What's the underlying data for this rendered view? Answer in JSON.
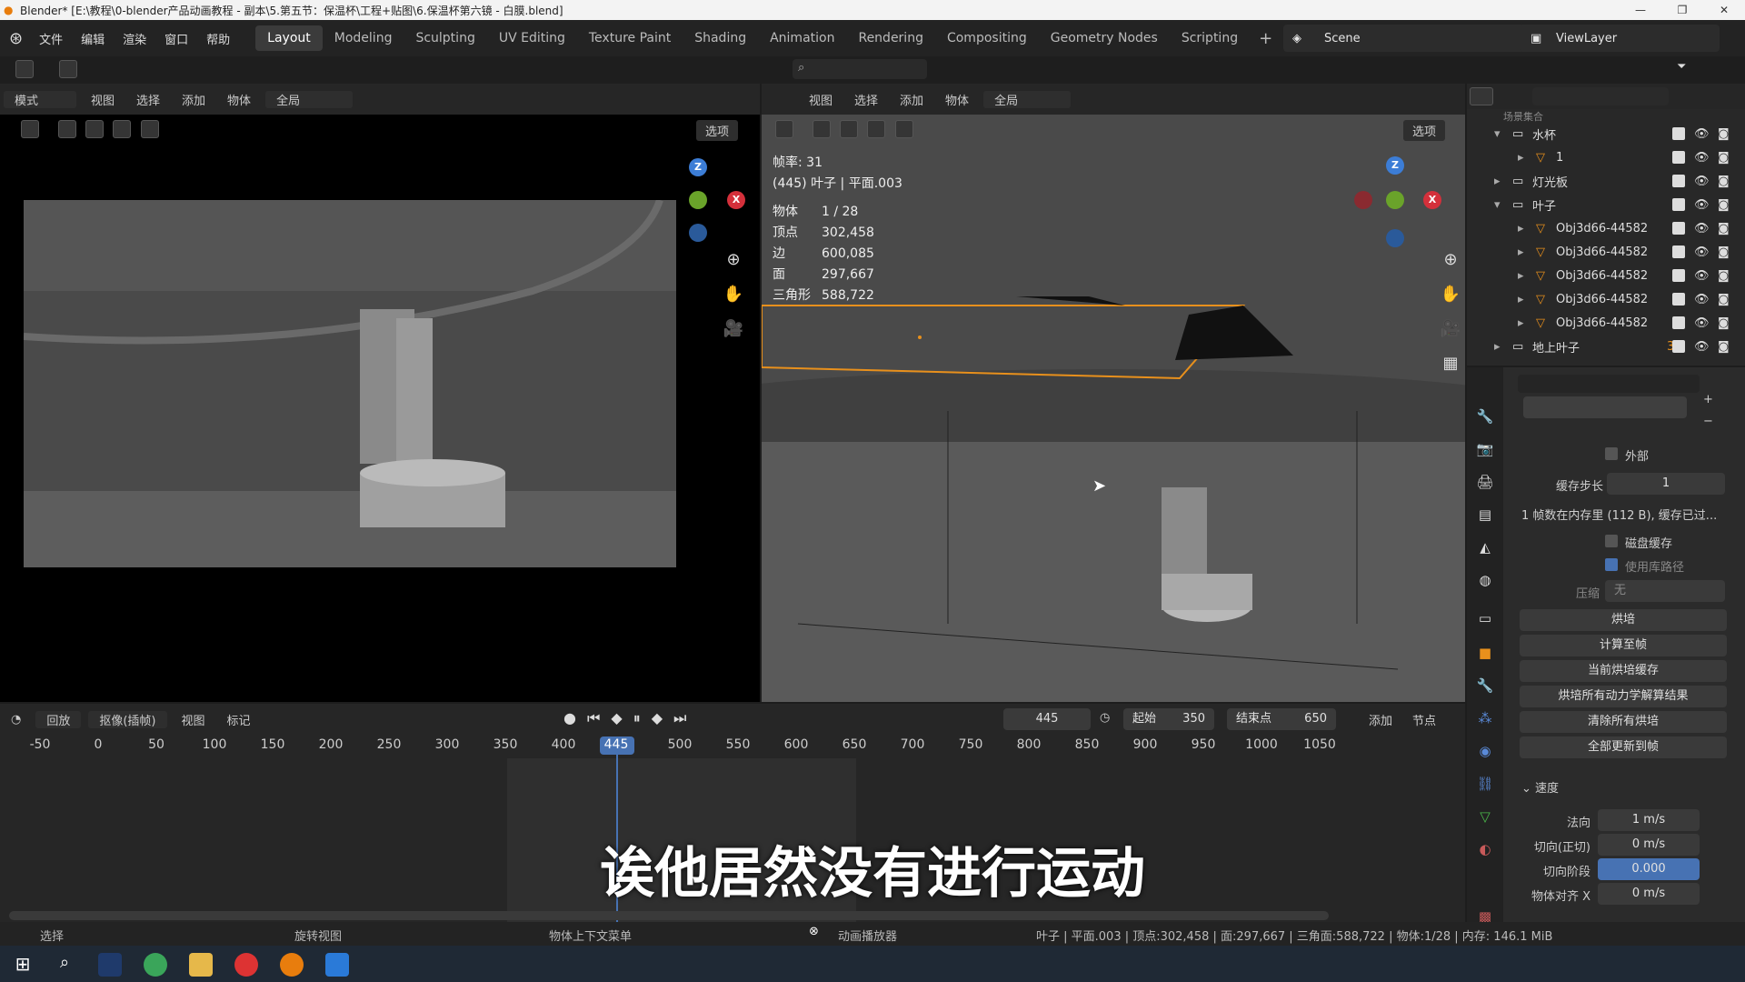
{
  "window": {
    "title": "Blender* [E:\\教程\\0-blender产品动画教程 - 副本\\5.第五节：保温杯\\工程+贴图\\6.保温杯第六镜 - 白膜.blend]"
  },
  "menu": [
    "文件",
    "编辑",
    "渲染",
    "窗口",
    "帮助"
  ],
  "workspaces": [
    "Layout",
    "Modeling",
    "Sculpting",
    "UV Editing",
    "Texture Paint",
    "Shading",
    "Animation",
    "Rendering",
    "Compositing",
    "Geometry Nodes",
    "Scripting"
  ],
  "active_workspace": "Layout",
  "scene": "Scene",
  "view_layer": "ViewLayer",
  "left_header": {
    "mode": "模式",
    "view": "视图",
    "select": "选择",
    "add": "添加",
    "object": "物体",
    "transform": "全局",
    "options": "选项"
  },
  "right_header": {
    "view": "视图",
    "select": "选择",
    "add": "添加",
    "object": "物体",
    "transform": "全局",
    "options": "选项"
  },
  "viewport_stats": {
    "fps": "帧率: 31",
    "name": "(445) 叶子 | 平面.003",
    "rows": [
      {
        "k": "物体",
        "v": "1 / 28"
      },
      {
        "k": "顶点",
        "v": "302,458"
      },
      {
        "k": "边",
        "v": "600,085"
      },
      {
        "k": "面",
        "v": "297,667"
      },
      {
        "k": "三角形",
        "v": "588,722"
      }
    ]
  },
  "gizmo": {
    "z": "Z",
    "x": "X"
  },
  "outliner": {
    "partial_top": "场景集合",
    "items": [
      {
        "label": "水杯",
        "indent": 0,
        "expanded": true
      },
      {
        "label": "1",
        "indent": 1
      },
      {
        "label": "灯光板",
        "indent": 0
      },
      {
        "label": "叶子",
        "indent": 0,
        "expanded": true
      },
      {
        "label": "Obj3d66-44582",
        "indent": 1
      },
      {
        "label": "Obj3d66-44582",
        "indent": 1
      },
      {
        "label": "Obj3d66-44582",
        "indent": 1
      },
      {
        "label": "Obj3d66-44582",
        "indent": 1
      },
      {
        "label": "Obj3d66-44582",
        "indent": 1
      },
      {
        "label": "地上叶子",
        "indent": 0,
        "badge": "3"
      }
    ]
  },
  "properties": {
    "external": "外部",
    "cache_step_label": "缓存步长",
    "cache_step": "1",
    "cache_info": "1 帧数在内存里 (112 B), 缓存已过...",
    "disk_cache": "磁盘缓存",
    "use_lib_path": "使用库路径",
    "compression_label": "压缩",
    "compression": "无",
    "buttons": [
      "烘培",
      "计算至帧",
      "当前烘培缓存",
      "烘培所有动力学解算结果",
      "清除所有烘培",
      "全部更新到帧"
    ],
    "velocity_section": "速度",
    "velocity": [
      {
        "label": "法向",
        "value": "1 m/s"
      },
      {
        "label": "切向(正切)",
        "value": "0 m/s"
      },
      {
        "label": "切向阶段",
        "value": "0.000"
      },
      {
        "label": "物体对齐 X",
        "value": "0 m/s"
      }
    ]
  },
  "timeline": {
    "playback": "回放",
    "keying": "抠像(插帧)",
    "view": "视图",
    "marker": "标记",
    "current_frame": "445",
    "start_label": "起始",
    "start": "350",
    "end_label": "结束点",
    "end": "650",
    "add": "添加",
    "node": "节点",
    "ticks": [
      "-50",
      "0",
      "50",
      "100",
      "150",
      "200",
      "250",
      "300",
      "350",
      "400",
      "445",
      "500",
      "550",
      "600",
      "650",
      "700",
      "750",
      "800",
      "850",
      "900",
      "950",
      "1000",
      "1050"
    ]
  },
  "subtitle": "诶他居然没有进行运动",
  "statusbar": {
    "select": "选择",
    "rotate": "旋转视图",
    "context": "物体上下文菜单",
    "player": "动画播放器",
    "info": "叶子 | 平面.003 | 顶点:302,458 | 面:297,667 | 三角面:588,722 | 物体:1/28 | 内存: 146.1 MiB"
  }
}
